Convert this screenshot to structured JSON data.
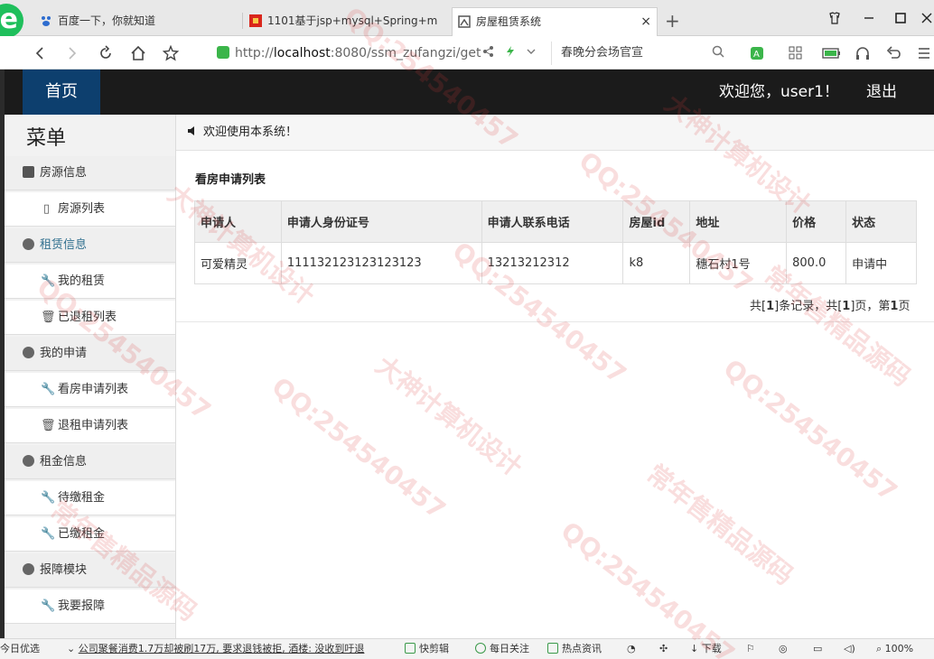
{
  "browser": {
    "tabs": [
      {
        "label": "百度一下，你就知道"
      },
      {
        "label": "1101基于jsp+mysql+Spring+m"
      },
      {
        "label": "房屋租赁系统",
        "close": "×"
      }
    ],
    "new_tab": "+",
    "url_scheme": "http://",
    "url_host": "localhost",
    "url_rest": ":8080/ssm_zufangzi/get",
    "search_text": "春晚分会场官宣"
  },
  "header": {
    "home": "首页",
    "welcome": "欢迎您，user1！",
    "logout": "退出"
  },
  "sidebar": {
    "title": "菜单",
    "groups": [
      {
        "label": "房源信息",
        "items": [
          "房源列表"
        ]
      },
      {
        "label": "租赁信息",
        "items": [
          "我的租赁",
          "已退租列表"
        ]
      },
      {
        "label": "我的申请",
        "items": [
          "看房申请列表",
          "退租申请列表"
        ]
      },
      {
        "label": "租金信息",
        "items": [
          "待缴租金",
          "已缴租金"
        ]
      },
      {
        "label": "报障模块",
        "items": [
          "我要报障"
        ]
      }
    ]
  },
  "notice": "欢迎使用本系统！",
  "main": {
    "title": "看房申请列表",
    "columns": [
      "申请人",
      "申请人身份证号",
      "申请人联系电话",
      "房屋id",
      "地址",
      "价格",
      "状态"
    ],
    "rows": [
      [
        "可爱精灵",
        "111132123123123123",
        "13213212312",
        "k8",
        "穗石村1号",
        "800.0",
        "申请中"
      ]
    ],
    "pager": {
      "p1": "共[",
      "total": "1",
      "p2": "]条记录，共[",
      "pages": "1",
      "p3": "]页，第",
      "current": "1",
      "p4": "页"
    }
  },
  "statusbar": {
    "item0": "今日优选",
    "news": "公司聚餐消费1.7万却被刷17万, 要求退钱被拒, 酒楼: 没收到吁退",
    "quick_edit": "快剪辑",
    "daily": "每日关注",
    "hot": "热点资讯",
    "download": "下载",
    "zoom": "100%"
  },
  "watermark": {
    "qq": "QQ:254540457",
    "a": "大神计算机设计",
    "b": "常年售精品源码"
  }
}
